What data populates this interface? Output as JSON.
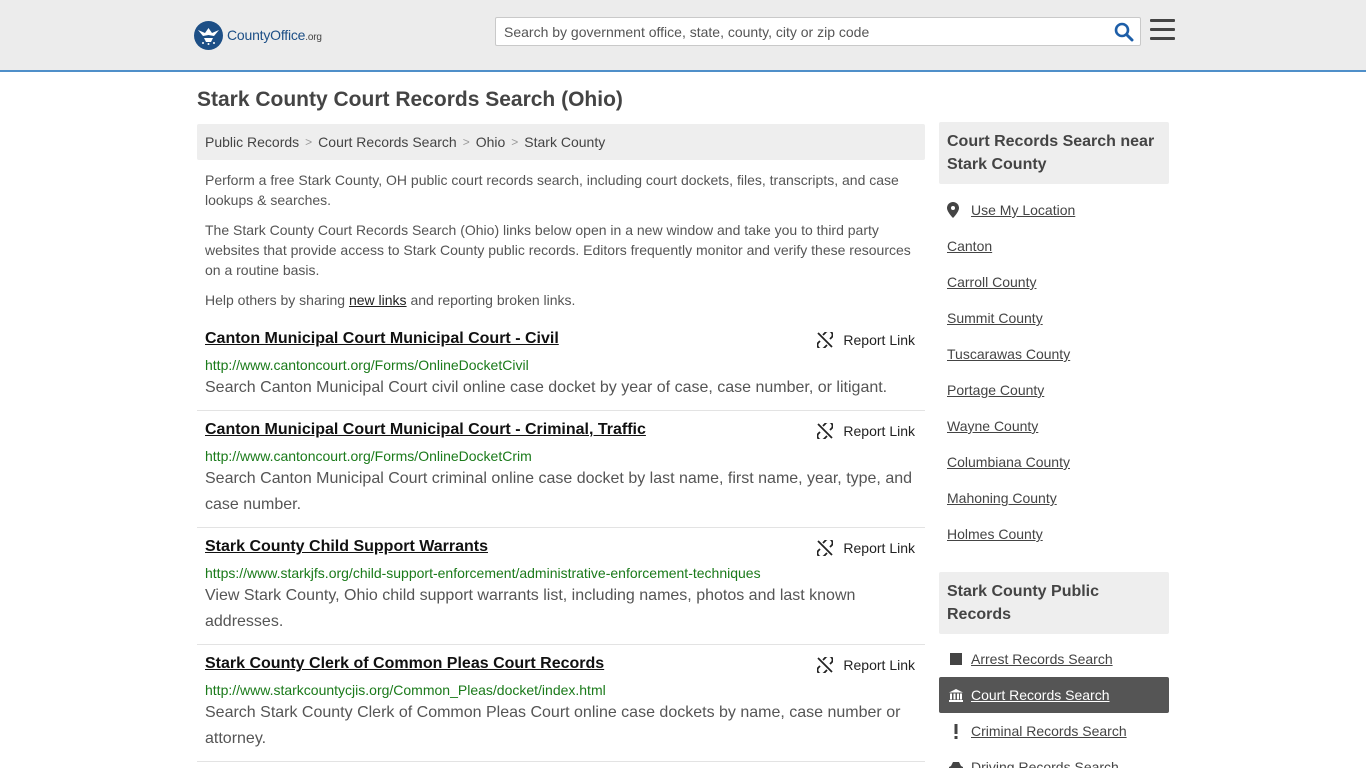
{
  "header": {
    "logo_main": "CountyOffice",
    "logo_tld": ".org",
    "search_placeholder": "Search by government office, state, county, city or zip code"
  },
  "page_title": "Stark County Court Records Search (Ohio)",
  "breadcrumb": [
    "Public Records",
    "Court Records Search",
    "Ohio",
    "Stark County"
  ],
  "intro": {
    "p1": "Perform a free Stark County, OH public court records search, including court dockets, files, transcripts, and case lookups & searches.",
    "p2": "The Stark County Court Records Search (Ohio) links below open in a new window and take you to third party websites that provide access to Stark County public records. Editors frequently monitor and verify these resources on a routine basis.",
    "p3_before": "Help others by sharing ",
    "p3_link": "new links",
    "p3_after": " and reporting broken links."
  },
  "report_label": "Report Link",
  "entries": [
    {
      "title": "Canton Municipal Court Municipal Court - Civil",
      "url": "http://www.cantoncourt.org/Forms/OnlineDocketCivil",
      "desc": "Search Canton Municipal Court civil online case docket by year of case, case number, or litigant."
    },
    {
      "title": "Canton Municipal Court Municipal Court - Criminal, Traffic",
      "url": "http://www.cantoncourt.org/Forms/OnlineDocketCrim",
      "desc": "Search Canton Municipal Court criminal online case docket by last name, first name, year, type, and case number."
    },
    {
      "title": "Stark County Child Support Warrants",
      "url": "https://www.starkjfs.org/child-support-enforcement/administrative-enforcement-techniques",
      "desc": "View Stark County, Ohio child support warrants list, including names, photos and last known addresses."
    },
    {
      "title": "Stark County Clerk of Common Pleas Court Records",
      "url": "http://www.starkcountycjis.org/Common_Pleas/docket/index.html",
      "desc": "Search Stark County Clerk of Common Pleas Court online case dockets by name, case number or attorney."
    }
  ],
  "sidebar": {
    "near_title": "Court Records Search near Stark County",
    "use_location": "Use My Location",
    "near_links": [
      "Canton",
      "Carroll County",
      "Summit County",
      "Tuscarawas County",
      "Portage County",
      "Wayne County",
      "Columbiana County",
      "Mahoning County",
      "Holmes County"
    ],
    "public_title": "Stark County Public Records",
    "public_links": [
      {
        "label": "Arrest Records Search",
        "icon": "square-icon",
        "active": false
      },
      {
        "label": "Court Records Search",
        "icon": "courthouse-icon",
        "active": true
      },
      {
        "label": "Criminal Records Search",
        "icon": "exclamation-icon",
        "active": false
      },
      {
        "label": "Driving Records Search",
        "icon": "car-icon",
        "active": false
      }
    ]
  }
}
